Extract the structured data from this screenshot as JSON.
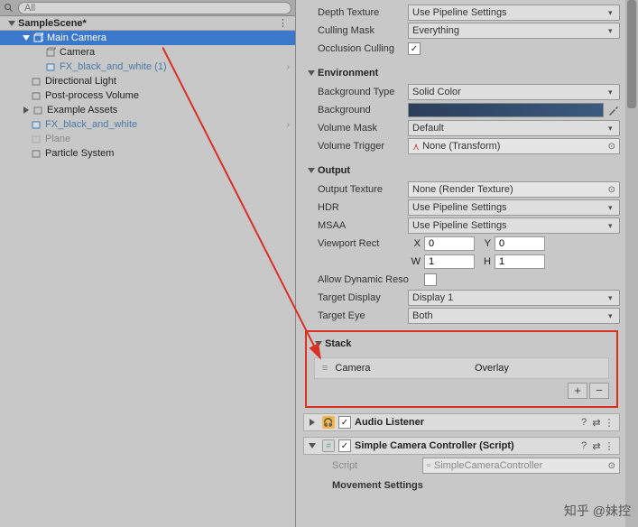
{
  "search": {
    "placeholder": "All"
  },
  "scene": {
    "name": "SampleScene*"
  },
  "tree": [
    {
      "label": "Main Camera",
      "prefab": false,
      "selected": true,
      "foldout": true,
      "indent": 1,
      "chev": false
    },
    {
      "label": "Camera",
      "prefab": false,
      "indent": 2
    },
    {
      "label": "FX_black_and_white (1)",
      "prefab": true,
      "indent": 2,
      "chev": true
    },
    {
      "label": "Directional Light",
      "prefab": false,
      "indent": 1
    },
    {
      "label": "Post-process Volume",
      "prefab": false,
      "indent": 1
    },
    {
      "label": "Example Assets",
      "prefab": false,
      "indent": 1,
      "foldout": true,
      "closed": true
    },
    {
      "label": "FX_black_and_white",
      "prefab": true,
      "indent": 1,
      "chev": true
    },
    {
      "label": "Plane",
      "prefab": false,
      "greyed": true,
      "indent": 1
    },
    {
      "label": "Particle System",
      "prefab": false,
      "indent": 1
    }
  ],
  "props": {
    "depthTexture": {
      "label": "Depth Texture",
      "value": "Use Pipeline Settings"
    },
    "cullingMask": {
      "label": "Culling Mask",
      "value": "Everything"
    },
    "occlusionCulling": {
      "label": "Occlusion Culling",
      "checked": true
    }
  },
  "env": {
    "title": "Environment",
    "bgType": {
      "label": "Background Type",
      "value": "Solid Color"
    },
    "bg": {
      "label": "Background"
    },
    "volMask": {
      "label": "Volume Mask",
      "value": "Default"
    },
    "volTrigger": {
      "label": "Volume Trigger",
      "value": "None (Transform)"
    }
  },
  "output": {
    "title": "Output",
    "outTex": {
      "label": "Output Texture",
      "value": "None (Render Texture)"
    },
    "hdr": {
      "label": "HDR",
      "value": "Use Pipeline Settings"
    },
    "msaa": {
      "label": "MSAA",
      "value": "Use Pipeline Settings"
    },
    "viewport": {
      "label": "Viewport Rect",
      "x": "0",
      "y": "0",
      "w": "1",
      "h": "1"
    },
    "dynRes": {
      "label": "Allow Dynamic Reso",
      "checked": false
    },
    "display": {
      "label": "Target Display",
      "value": "Display 1"
    },
    "eye": {
      "label": "Target Eye",
      "value": "Both"
    }
  },
  "stack": {
    "title": "Stack",
    "item": {
      "name": "Camera",
      "type": "Overlay"
    }
  },
  "components": {
    "audio": {
      "name": "Audio Listener"
    },
    "script": {
      "name": "Simple Camera Controller (Script)",
      "scriptLabel": "Script",
      "scriptValue": "SimpleCameraController"
    },
    "movement": {
      "label": "Movement Settings"
    }
  },
  "watermark": "知乎 @妹控"
}
